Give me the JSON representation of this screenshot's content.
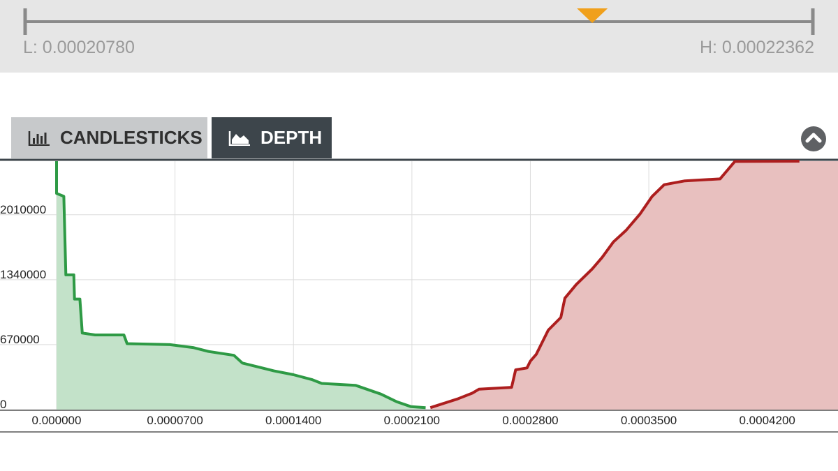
{
  "range": {
    "low_label": "L: 0.00020780",
    "high_label": "H: 0.00022362",
    "marker_fraction": 0.72,
    "marker_color": "#f0a01c"
  },
  "tabs": [
    {
      "label": "CANDLESTICKS",
      "icon": "bar-chart-icon",
      "active": false
    },
    {
      "label": "DEPTH",
      "icon": "area-chart-icon",
      "active": true
    }
  ],
  "collapse_icon": "chevron-up-icon",
  "chart_data": {
    "type": "area",
    "xlim": [
      0,
      0.000442
    ],
    "ylim": [
      0,
      2570000
    ],
    "x_ticks": [
      {
        "value": 0,
        "label": "0.000000"
      },
      {
        "value": 7e-05,
        "label": "0.0000700"
      },
      {
        "value": 0.00014,
        "label": "0.0001400"
      },
      {
        "value": 0.00021,
        "label": "0.0002100"
      },
      {
        "value": 0.00028,
        "label": "0.0002800"
      },
      {
        "value": 0.00035,
        "label": "0.0003500"
      },
      {
        "value": 0.00042,
        "label": "0.0004200"
      }
    ],
    "y_ticks": [
      {
        "value": 0,
        "label": "0"
      },
      {
        "value": 670000,
        "label": "670000"
      },
      {
        "value": 1340000,
        "label": "1340000"
      },
      {
        "value": 2010000,
        "label": "2010000"
      }
    ],
    "grid": true,
    "series": [
      {
        "side": "bids",
        "line_color": "#2e9a45",
        "fill_color": "#c3e2c9",
        "points": [
          [
            0.0,
            2570000
          ],
          [
            0.0,
            2230000
          ],
          [
            4.3e-06,
            2200000
          ],
          [
            5.5e-06,
            1390000
          ],
          [
            1.02e-05,
            1390000
          ],
          [
            1.06e-05,
            1140000
          ],
          [
            1.38e-05,
            1140000
          ],
          [
            1.52e-05,
            790000
          ],
          [
            2.28e-05,
            770000
          ],
          [
            3.98e-05,
            770000
          ],
          [
            4.17e-05,
            680000
          ],
          [
            6.7e-05,
            670000
          ],
          [
            8.07e-05,
            640000
          ],
          [
            8.98e-05,
            600000
          ],
          [
            0.0001048,
            560000
          ],
          [
            0.0001098,
            480000
          ],
          [
            0.0001283,
            400000
          ],
          [
            0.00014,
            360000
          ],
          [
            0.0001508,
            310000
          ],
          [
            0.0001567,
            270000
          ],
          [
            0.0001768,
            250000
          ],
          [
            0.0001917,
            160000
          ],
          [
            0.0002012,
            80000
          ],
          [
            0.0002095,
            30000
          ],
          [
            0.0002181,
            20000
          ]
        ]
      },
      {
        "side": "asks",
        "line_color": "#ad1e1e",
        "fill_color": "#e8c0bf",
        "points": [
          [
            0.0002209,
            20000
          ],
          [
            0.000237,
            110000
          ],
          [
            0.0002457,
            170000
          ],
          [
            0.0002496,
            210000
          ],
          [
            0.0002689,
            230000
          ],
          [
            0.0002713,
            410000
          ],
          [
            0.000278,
            430000
          ],
          [
            0.00028,
            500000
          ],
          [
            0.0002835,
            570000
          ],
          [
            0.0002906,
            820000
          ],
          [
            0.000298,
            950000
          ],
          [
            0.0003004,
            1150000
          ],
          [
            0.0003071,
            1290000
          ],
          [
            0.0003165,
            1450000
          ],
          [
            0.0003224,
            1570000
          ],
          [
            0.0003291,
            1730000
          ],
          [
            0.0003366,
            1850000
          ],
          [
            0.0003449,
            2020000
          ],
          [
            0.000352,
            2200000
          ],
          [
            0.0003591,
            2320000
          ],
          [
            0.0003713,
            2360000
          ],
          [
            0.0003921,
            2380000
          ],
          [
            0.0004008,
            2560000
          ],
          [
            0.000439,
            2580000
          ]
        ]
      }
    ]
  }
}
